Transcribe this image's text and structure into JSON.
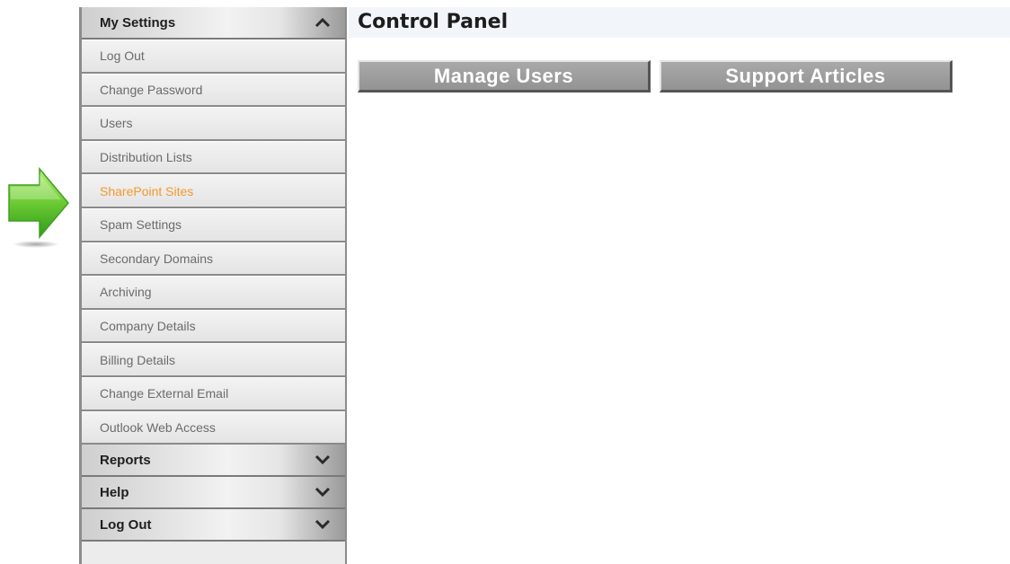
{
  "sidebar": {
    "my_settings": {
      "label": "My Settings",
      "items": [
        {
          "label": "Log Out"
        },
        {
          "label": "Change Password"
        },
        {
          "label": "Users"
        },
        {
          "label": "Distribution Lists"
        },
        {
          "label": "SharePoint Sites",
          "active": true
        },
        {
          "label": "Spam Settings"
        },
        {
          "label": "Secondary Domains"
        },
        {
          "label": "Archiving"
        },
        {
          "label": "Company Details"
        },
        {
          "label": "Billing Details"
        },
        {
          "label": "Change External Email"
        },
        {
          "label": "Outlook Web Access"
        }
      ]
    },
    "reports": {
      "label": "Reports"
    },
    "help": {
      "label": "Help"
    },
    "logout": {
      "label": "Log Out"
    }
  },
  "main": {
    "title": "Control Panel",
    "buttons": {
      "manage_users": "Manage Users",
      "support_articles": "Support Articles"
    }
  },
  "icons": {
    "pointer": "arrow-right-icon",
    "collapse": "chevron-up-icon",
    "expand": "chevron-down-icon"
  },
  "colors": {
    "active_item": "#f4982d",
    "arrow": "#5cb82e"
  }
}
